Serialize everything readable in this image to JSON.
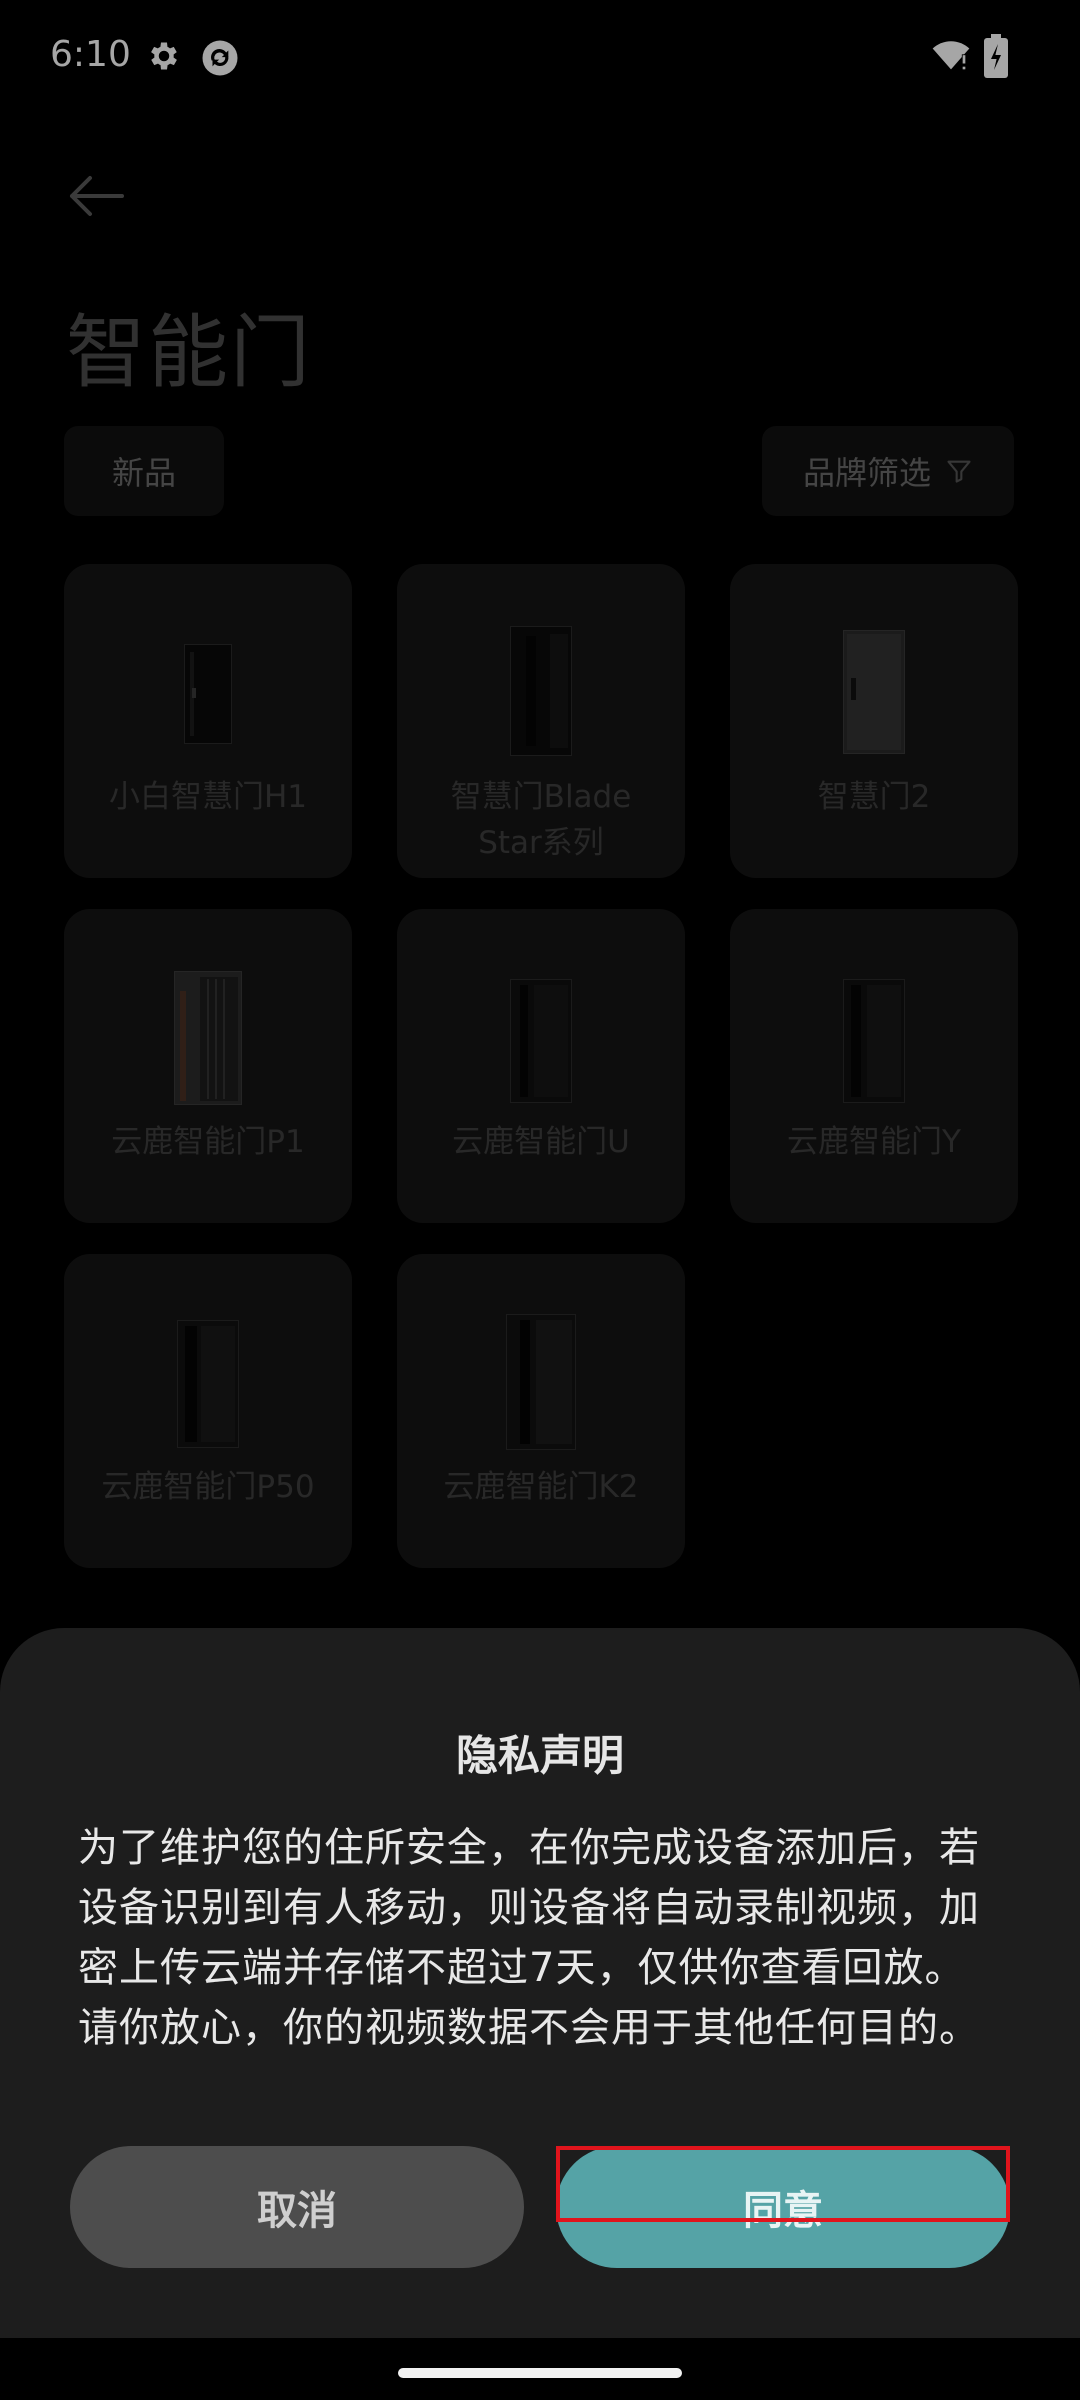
{
  "status_bar": {
    "time": "6:10"
  },
  "page": {
    "title": "智能门",
    "filters": {
      "new_label": "新品",
      "brand_label": "品牌筛选"
    },
    "products": [
      {
        "label_line1": "小白智慧门H1",
        "label_line2": ""
      },
      {
        "label_line1": "智慧门Blade",
        "label_line2": "Star系列"
      },
      {
        "label_line1": "智慧门2",
        "label_line2": ""
      },
      {
        "label_line1": "云鹿智能门P1",
        "label_line2": ""
      },
      {
        "label_line1": "云鹿智能门U",
        "label_line2": ""
      },
      {
        "label_line1": "云鹿智能门Y",
        "label_line2": ""
      },
      {
        "label_line1": "云鹿智能门P50",
        "label_line2": ""
      },
      {
        "label_line1": "云鹿智能门K2",
        "label_line2": ""
      }
    ]
  },
  "dialog": {
    "title": "隐私声明",
    "body_lines": [
      "为了维护您的住所安全，在你完成设备添加后，若",
      "设备识别到有人移动，则设备将自动录制视频，加",
      "密上传云端并存储不超过7天，仅供你查看回放。",
      "请你放心，你的视频数据不会用于其他任何目的。"
    ],
    "cancel_label": "取消",
    "agree_label": "同意"
  },
  "colors": {
    "agree_button": "#55a3a6",
    "cancel_button": "#4d4d4d",
    "sheet_bg": "#1d1d1d",
    "highlight": "#e0141c"
  },
  "icons": [
    "settings-gear-icon",
    "sync-app-icon",
    "wifi-alert-icon",
    "battery-charging-icon",
    "back-arrow-icon",
    "filter-funnel-icon",
    "door-icon"
  ]
}
